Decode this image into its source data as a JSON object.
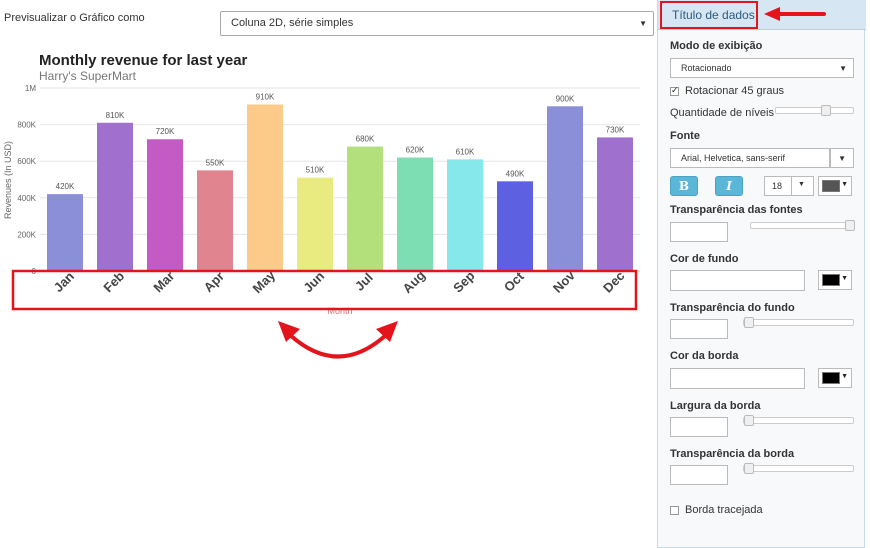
{
  "preview": {
    "label": "Previsualizar o Gráfico como",
    "selected_type": "Coluna 2D, série simples"
  },
  "side_panel": {
    "header_title": "Título de dados",
    "display_mode_label": "Modo de exibição",
    "display_mode_value": "Rotacionado",
    "rotate_45_label": "Rotacionar 45 graus",
    "rotate_45_checked": true,
    "levels_label": "Quantidade de níveis",
    "font_label": "Fonte",
    "font_value": "Arial, Helvetica, sans-serif",
    "bold_label": "B",
    "italic_label": "I",
    "font_size": "18",
    "font_opacity_label": "Transparência das fontes",
    "bg_color_label": "Cor de fundo",
    "bg_opacity_label": "Transparência do fundo",
    "border_color_label": "Cor da borda",
    "border_width_label": "Largura da borda",
    "border_opacity_label": "Transparência da borda",
    "dashed_border_label": "Borda tracejada",
    "font_color": "#555555",
    "bg_color": "#000000",
    "border_color": "#000000"
  },
  "highlight_color": "#e3141b",
  "chart_data": {
    "type": "bar",
    "title": "Monthly revenue for last year",
    "subtitle": "Harry's SuperMart",
    "xlabel": "Month",
    "ylabel": "Revenues (In USD)",
    "ylim": [
      0,
      1000000
    ],
    "yticks": [
      0,
      200000,
      400000,
      600000,
      800000,
      1000000
    ],
    "ytick_labels": [
      "0",
      "200K",
      "400K",
      "600K",
      "800K",
      "1M"
    ],
    "grid": true,
    "categories": [
      "Jan",
      "Feb",
      "Mar",
      "Apr",
      "May",
      "Jun",
      "Jul",
      "Aug",
      "Sep",
      "Oct",
      "Nov",
      "Dec"
    ],
    "values": [
      420000,
      810000,
      720000,
      550000,
      910000,
      510000,
      680000,
      620000,
      610000,
      490000,
      900000,
      730000
    ],
    "value_labels": [
      "420K",
      "810K",
      "720K",
      "550K",
      "910K",
      "510K",
      "680K",
      "620K",
      "610K",
      "490K",
      "900K",
      "730K"
    ],
    "colors": [
      "#8b8fd8",
      "#a070cf",
      "#c45bc5",
      "#e0848f",
      "#fccb8a",
      "#e9eb80",
      "#b3e07a",
      "#7ddeb3",
      "#87e8ec",
      "#5c60e1",
      "#8b8fd8",
      "#a070cf"
    ],
    "label_rotation": "rotated 45 degrees"
  }
}
